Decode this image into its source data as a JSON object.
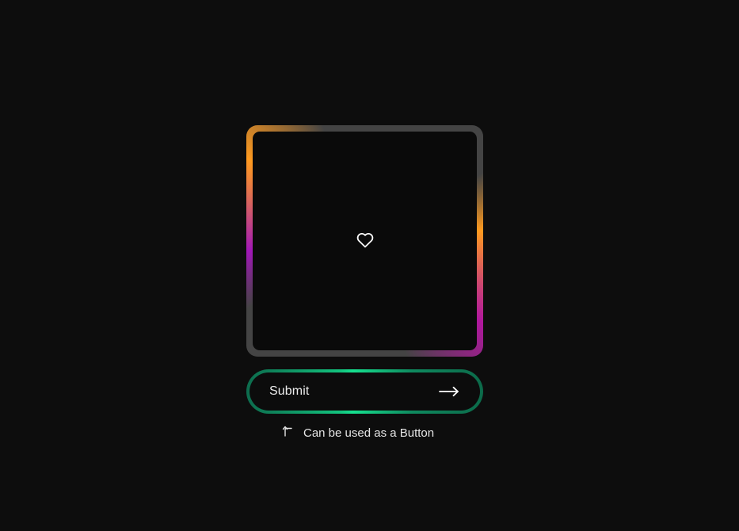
{
  "card": {
    "icon": "heart-icon",
    "border_colors": [
      "#444444",
      "#ff9a1f",
      "#b0179e"
    ]
  },
  "submit_button": {
    "label": "Submit",
    "icon": "arrow-right-icon",
    "border_colors": [
      "#0d6b4d",
      "#16e08f"
    ]
  },
  "hint": {
    "icon": "return-arrow-icon",
    "text": "Can be used as a Button"
  },
  "colors": {
    "background": "#0d0d0d",
    "text": "#e6e6e6"
  }
}
